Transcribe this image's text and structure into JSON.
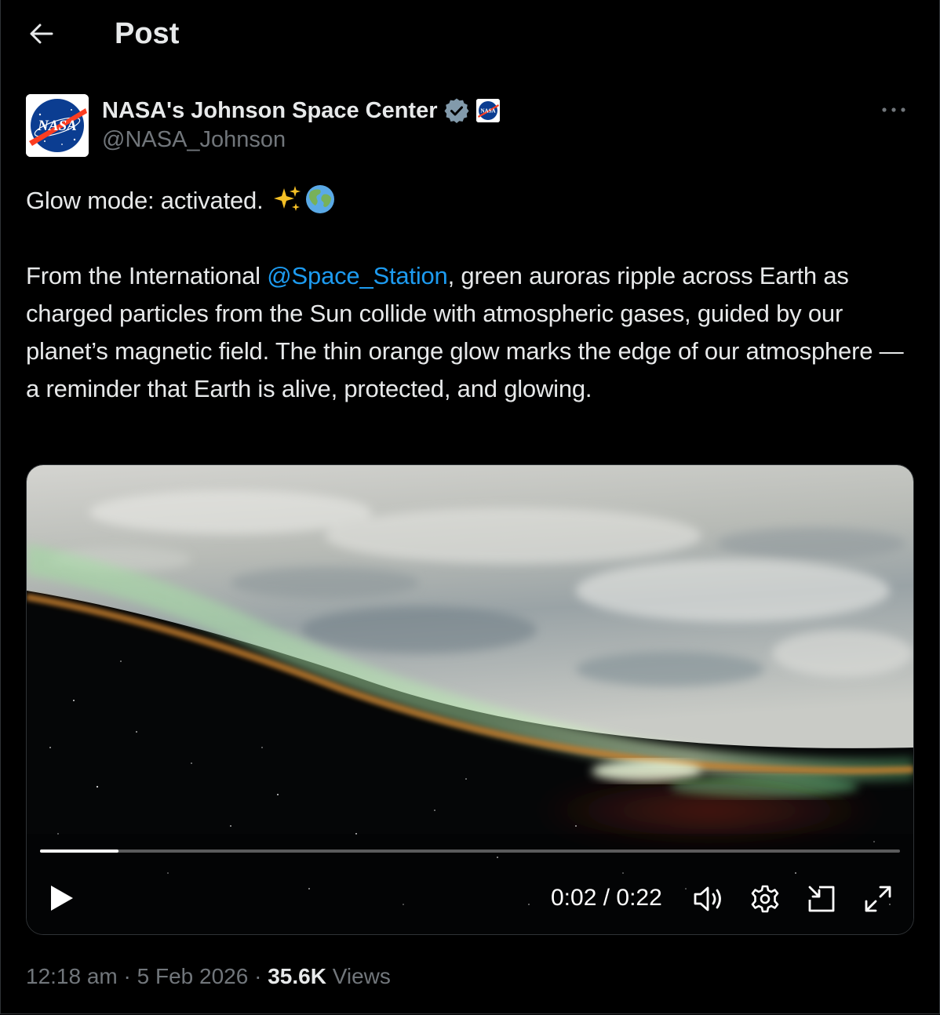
{
  "header": {
    "title": "Post"
  },
  "author": {
    "name": "NASA's Johnson Space Center",
    "handle": "@NASA_Johnson",
    "avatar_text": "NASA",
    "badge_text": "NASA"
  },
  "post": {
    "line1": "Glow mode: activated. ",
    "emoji": [
      "sparkles-emoji",
      "globe-emoji"
    ],
    "para_before_mention": "From the International ",
    "mention": "@Space_Station",
    "para_after_mention": ", green auroras ripple across Earth as charged particles from the Sun collide with atmospheric gases, guided by our planet’s magnetic field. The thin orange glow marks the edge of our atmosphere — a reminder that Earth is alive, protected, and glowing."
  },
  "video": {
    "time": "0:02 / 0:22",
    "progress_fraction": 0.0909,
    "controls": [
      "play-icon",
      "volume-icon",
      "settings-icon",
      "pip-icon",
      "fullscreen-icon"
    ]
  },
  "meta": {
    "time": "12:18 am",
    "sep1": " · ",
    "date": "5 Feb 2026",
    "sep2": " · ",
    "views_count": "35.6K",
    "views_label": " Views"
  },
  "colors": {
    "background": "#000000",
    "text": "#e7e9ea",
    "secondary": "#71767b",
    "link": "#1d9bf0",
    "verified": "#829aab"
  }
}
